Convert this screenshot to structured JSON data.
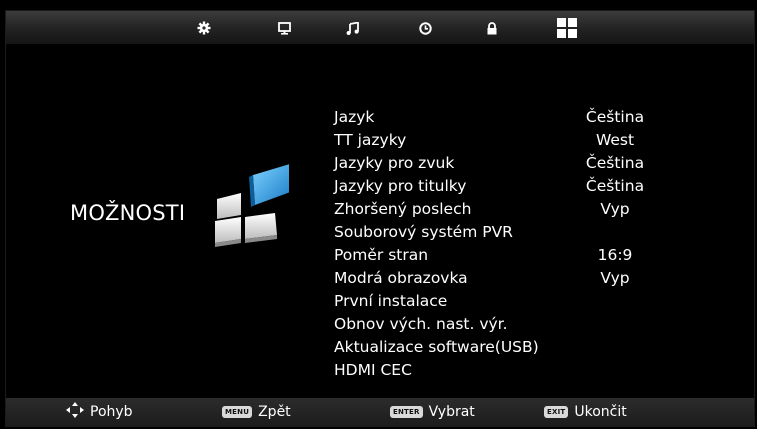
{
  "tabs": [
    {
      "name": "gear-icon",
      "active": false
    },
    {
      "name": "monitor-icon",
      "active": false
    },
    {
      "name": "music-note-icon",
      "active": false
    },
    {
      "name": "clock-icon",
      "active": false
    },
    {
      "name": "lock-icon",
      "active": false
    },
    {
      "name": "options-grid-icon",
      "active": true
    }
  ],
  "page": {
    "title": "MOŽNOSTI"
  },
  "menu": {
    "items": [
      {
        "label": "Jazyk",
        "value": "Čeština"
      },
      {
        "label": "TT jazyky",
        "value": "West"
      },
      {
        "label": "Jazyky pro zvuk",
        "value": "Čeština"
      },
      {
        "label": "Jazyky pro titulky",
        "value": "Čeština"
      },
      {
        "label": "Zhoršený poslech",
        "value": "Vyp"
      },
      {
        "label": "Souborový systém PVR",
        "value": ""
      },
      {
        "label": "Poměr stran",
        "value": "16:9"
      },
      {
        "label": "Modrá obrazovka",
        "value": "Vyp"
      },
      {
        "label": "První instalace",
        "value": ""
      },
      {
        "label": "Obnov vých. nast. výr.",
        "value": ""
      },
      {
        "label": "Aktualizace software(USB)",
        "value": ""
      },
      {
        "label": "HDMI CEC",
        "value": ""
      }
    ]
  },
  "footer": {
    "move": {
      "icon": "dpad-arrows-icon",
      "label": "Pohyb"
    },
    "back": {
      "key": "MENU",
      "label": "Zpět"
    },
    "select": {
      "key": "ENTER",
      "label": "Vybrat"
    },
    "exit": {
      "key": "EXIT",
      "label": "Ukončit"
    }
  },
  "colors": {
    "background": "#000000",
    "emblem_blue": "#2a9de0",
    "bar_top": "#3c3c3c"
  }
}
